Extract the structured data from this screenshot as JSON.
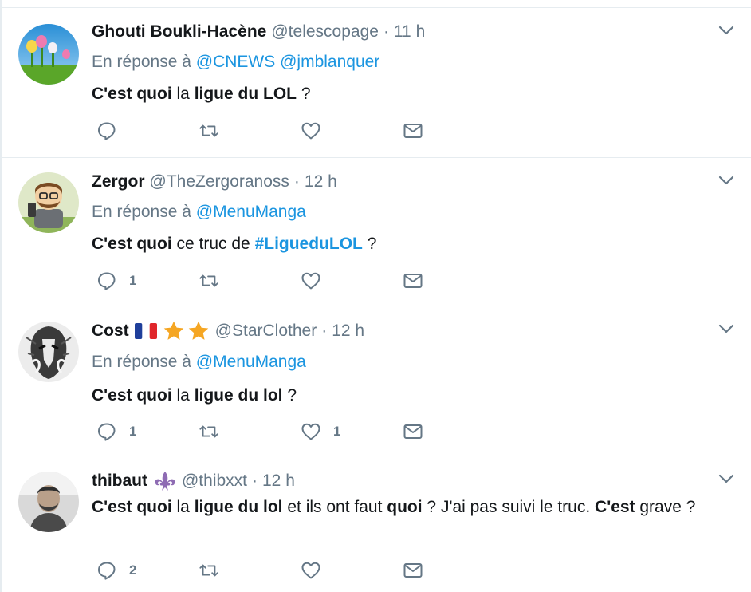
{
  "colors": {
    "link": "#1b95e0",
    "muted": "#657786",
    "text": "#14171a",
    "border": "#e6ecf0"
  },
  "tweets": [
    {
      "fullname": "Ghouti Boukli-Hacène",
      "handle": "@telescopage",
      "dot": "·",
      "time": "11 h",
      "reply_prefix": "En réponse à",
      "mentions": [
        "@CNEWS",
        "@jmblanquer"
      ],
      "text": [
        {
          "t": "C'est quoi",
          "b": true
        },
        {
          "t": " la ",
          "b": false
        },
        {
          "t": "ligue du LOL",
          "b": true
        },
        {
          "t": " ?",
          "b": false
        }
      ],
      "avatar": "tulips-avatar",
      "reply_count": "",
      "retweet_count": "",
      "like_count": ""
    },
    {
      "fullname": "Zergor",
      "handle": "@TheZergoranoss",
      "dot": "·",
      "time": "12 h",
      "reply_prefix": "En réponse à",
      "mentions": [
        "@MenuManga"
      ],
      "text": [
        {
          "t": "C'est quoi",
          "b": true
        },
        {
          "t": " ce truc de ",
          "b": false
        },
        {
          "t": "#LigueduLOL",
          "b": true,
          "link": true
        },
        {
          "t": " ?",
          "b": false
        }
      ],
      "avatar": "cartoon-avatar",
      "reply_count": "1",
      "retweet_count": "",
      "like_count": ""
    },
    {
      "fullname": "Cost",
      "badges": [
        "french-flag-icon",
        "star-icon",
        "star-icon"
      ],
      "handle": "@StarClother",
      "dot": "·",
      "time": "12 h",
      "reply_prefix": "En réponse à",
      "mentions": [
        "@MenuManga"
      ],
      "text": [
        {
          "t": "C'est quoi",
          "b": true
        },
        {
          "t": " la ",
          "b": false
        },
        {
          "t": "ligue du lol",
          "b": true
        },
        {
          "t": " ?",
          "b": false
        }
      ],
      "avatar": "sketch-avatar",
      "reply_count": "1",
      "retweet_count": "",
      "like_count": "1"
    },
    {
      "fullname": "thibaut",
      "badges": [
        "fleur-de-lis-icon"
      ],
      "handle": "@thibxxt",
      "dot": "·",
      "time": "12 h",
      "text": [
        {
          "t": "C'est quoi",
          "b": true
        },
        {
          "t": " la ",
          "b": false
        },
        {
          "t": "ligue du lol",
          "b": true
        },
        {
          "t": " et ils ont faut ",
          "b": false
        },
        {
          "t": "quoi",
          "b": true
        },
        {
          "t": " ? J'ai pas suivi le truc. ",
          "b": false
        },
        {
          "t": "C'est",
          "b": true
        },
        {
          "t": " grave ?",
          "b": false
        }
      ],
      "avatar": "photo-avatar",
      "reply_count": "2",
      "retweet_count": "",
      "like_count": ""
    }
  ]
}
